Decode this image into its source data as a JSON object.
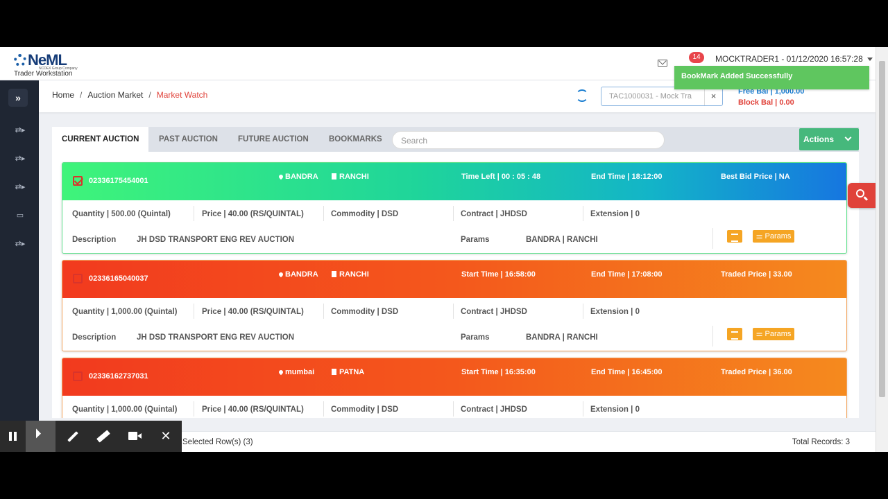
{
  "header": {
    "logo_text": "NeML",
    "logo_subtext": "NCDEX Group Company",
    "app_subtitle": "Trader Workstation",
    "notification_count": "14",
    "user_label": "MOCKTRADER1 - 01/12/2020 16:57:28"
  },
  "toast": {
    "message": "BookMark Added Successfully"
  },
  "breadcrumb": {
    "home": "Home",
    "section": "Auction Market",
    "current": "Market Watch",
    "separator": "/"
  },
  "trader_select": {
    "value": "TAC1000031 - Mock Tra",
    "clear": "×"
  },
  "balances": {
    "free": "Free Bal | 1,000.00",
    "block": "Block Bal | 0.00"
  },
  "tabs": [
    "CURRENT AUCTION",
    "PAST AUCTION",
    "FUTURE AUCTION",
    "BOOKMARKS"
  ],
  "search": {
    "placeholder": "Search"
  },
  "actions_label": "Actions",
  "auctions": [
    {
      "id": "02336175454001",
      "from": "BANDRA",
      "to": "RANCHI",
      "time1": "Time Left | 00 : 05 : 48",
      "time2": "End Time | 18:12:00",
      "price": "Best Bid Price | NA",
      "quantity": "Quantity | 500.00 (Quintal)",
      "unit_price": "Price | 40.00 (RS/QUINTAL)",
      "commodity": "Commodity | DSD",
      "contract": "Contract | JHDSD",
      "extension": "Extension | 0",
      "desc_label": "Description",
      "description": "JH DSD TRANSPORT ENG REV AUCTION",
      "params_label": "Params",
      "params": "BANDRA | RANCHI",
      "params_button": "Params",
      "bookmarked": true
    },
    {
      "id": "02336165040037",
      "from": "BANDRA",
      "to": "RANCHI",
      "time1": "Start Time | 16:58:00",
      "time2": "End Time | 17:08:00",
      "price": "Traded Price | 33.00",
      "quantity": "Quantity | 1,000.00 (Quintal)",
      "unit_price": "Price | 40.00 (RS/QUINTAL)",
      "commodity": "Commodity | DSD",
      "contract": "Contract | JHDSD",
      "extension": "Extension | 0",
      "desc_label": "Description",
      "description": "JH DSD TRANSPORT ENG REV AUCTION",
      "params_label": "Params",
      "params": "BANDRA | RANCHI",
      "params_button": "Params",
      "bookmarked": false
    },
    {
      "id": "02336162737031",
      "from": "mumbai",
      "to": "PATNA",
      "time1": "Start Time | 16:35:00",
      "time2": "End Time | 16:45:00",
      "price": "Traded Price | 36.00",
      "quantity": "Quantity | 1,000.00 (Quintal)",
      "unit_price": "Price | 40.00 (RS/QUINTAL)",
      "commodity": "Commodity | DSD",
      "contract": "Contract | JHDSD",
      "extension": "Extension | 0",
      "bookmarked": false
    }
  ],
  "footer": {
    "selected": "Selected Row(s) (3)",
    "total": "Total Records: 3"
  },
  "icons": {
    "sidebar": [
      "expand-icon",
      "auction-icon",
      "auction-icon",
      "auction-icon",
      "laptop-icon",
      "auction-icon"
    ],
    "header": [
      "mail-icon",
      "bell-icon",
      "refresh-icon",
      "search-icon"
    ],
    "recorder": [
      "pause-icon",
      "pointer-icon",
      "pen-icon",
      "marker-icon",
      "camera-icon",
      "close-icon"
    ]
  },
  "colors": {
    "accent_red": "#e0423a",
    "accent_blue": "#1d7fd1",
    "actions_green": "#46b87c",
    "toast_green": "#5fc65f",
    "params_orange": "#f5a524"
  }
}
